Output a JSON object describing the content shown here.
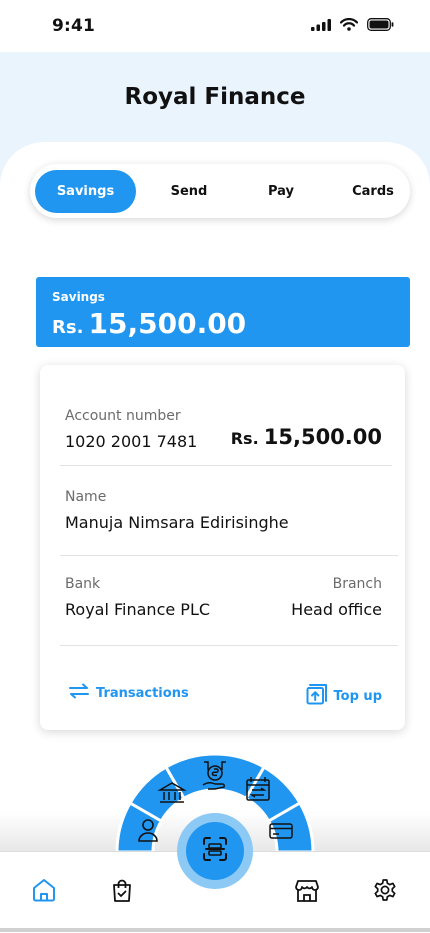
{
  "status_bar": {
    "time": "9:41"
  },
  "app": {
    "title": "Royal Finance"
  },
  "tabs": [
    {
      "label": "Savings",
      "active": true
    },
    {
      "label": "Send",
      "active": false
    },
    {
      "label": "Pay",
      "active": false
    },
    {
      "label": "Cards",
      "active": false
    }
  ],
  "banner": {
    "label": "Savings",
    "currency": "Rs.",
    "amount": "15,500.00"
  },
  "account": {
    "number_label": "Account number",
    "number": "1020 2001 7481",
    "currency": "Rs.",
    "balance": "15,500.00",
    "name_label": "Name",
    "name": "Manuja Nimsara Edirisinghe",
    "bank_label": "Bank",
    "bank": "Royal Finance PLC",
    "branch_label": "Branch",
    "branch": "Head office"
  },
  "actions": {
    "transactions_label": "Transactions",
    "topup_label": "Top up"
  },
  "quick_menu": {
    "icons": [
      "profile-icon",
      "bank-icon",
      "money-transfer-icon",
      "calendar-exchange-icon",
      "card-icon"
    ],
    "center_icon": "scan-icon"
  },
  "bottom_nav": {
    "items": [
      "home-icon",
      "shopping-bag-icon",
      "store-icon",
      "settings-icon"
    ],
    "active": "home-icon"
  },
  "colors": {
    "accent": "#2196f0",
    "accent_light": "#8cc9f5",
    "header_bg": "#eaf4fd"
  }
}
